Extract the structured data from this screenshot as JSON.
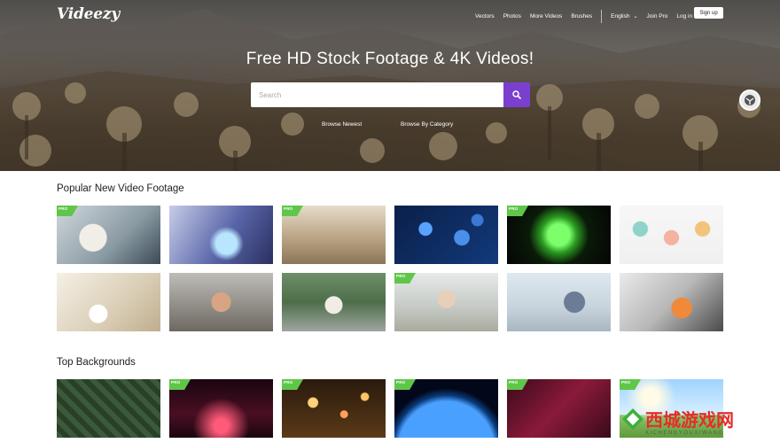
{
  "header": {
    "logo": "Videezy",
    "nav": [
      "Vectors",
      "Photos",
      "More Videos",
      "Brushes"
    ],
    "language": "English",
    "join_pro": "Join Pro",
    "log_in": "Log in",
    "sign_up": "Sign up"
  },
  "hero": {
    "title": "Free HD Stock Footage & 4K Videos!",
    "search_placeholder": "Search",
    "search_value": "",
    "browse_newest": "Browse Newest",
    "browse_category": "Browse By Category"
  },
  "sections": [
    {
      "title": "Popular New Video Footage",
      "items": [
        {
          "pro": true,
          "subject": "scientist-microscope"
        },
        {
          "pro": false,
          "subject": "lab-glassware"
        },
        {
          "pro": true,
          "subject": "laboratory-room"
        },
        {
          "pro": false,
          "subject": "virus-particles"
        },
        {
          "pro": true,
          "subject": "green-cell"
        },
        {
          "pro": false,
          "subject": "infographic-people"
        },
        {
          "pro": false,
          "subject": "coffee-desk"
        },
        {
          "pro": false,
          "subject": "man-sofa-phone"
        },
        {
          "pro": false,
          "subject": "woman-laptop-terrace"
        },
        {
          "pro": true,
          "subject": "woman-mask"
        },
        {
          "pro": false,
          "subject": "man-laptop-stressed"
        },
        {
          "pro": false,
          "subject": "cleaning-glove"
        }
      ]
    },
    {
      "title": "Top Backgrounds",
      "items": [
        {
          "pro": false,
          "subject": "green-maze"
        },
        {
          "pro": true,
          "subject": "red-particles"
        },
        {
          "pro": true,
          "subject": "golden-bokeh"
        },
        {
          "pro": true,
          "subject": "earth-space"
        },
        {
          "pro": true,
          "subject": "red-polygons"
        },
        {
          "pro": true,
          "subject": "sky-field"
        }
      ]
    }
  ],
  "pro_label": "PRO",
  "watermark": {
    "title": "西城游戏网",
    "subtitle": "XICHENGYOUXIWANG"
  },
  "colors": {
    "accent": "#7b3fd0",
    "pro_badge": "#5fc64a"
  }
}
